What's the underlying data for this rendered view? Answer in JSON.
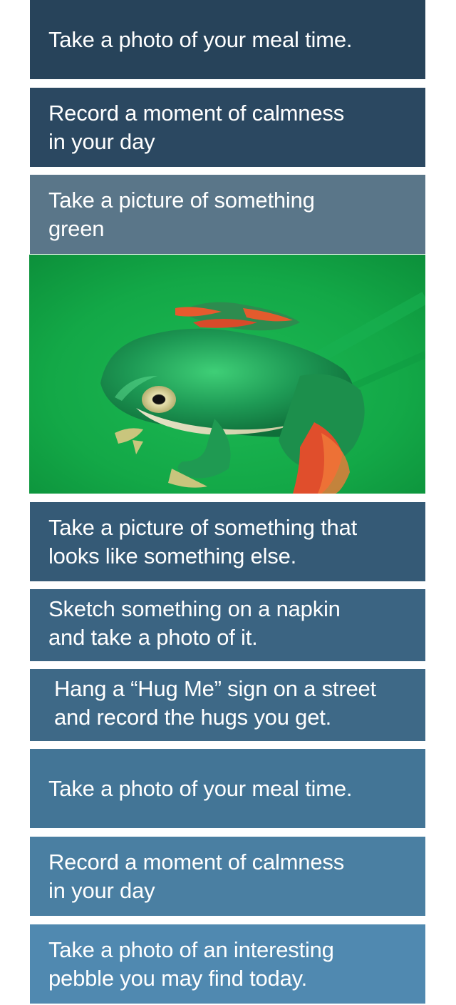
{
  "cards": [
    {
      "text": "Take a photo of your meal time."
    },
    {
      "text": "Record a moment of calmness\nin your day"
    },
    {
      "text": "Take a picture of something\ngreen"
    },
    {
      "text": "Take a picture of something that\nlooks like something else."
    },
    {
      "text": "Sketch something on a napkin\nand take a photo of it."
    },
    {
      "text": "Hang a “Hug Me” sign on a street\nand record the hugs you get."
    },
    {
      "text": "Take a photo of your meal time."
    },
    {
      "text": "Record a moment of calmness\nin your day"
    },
    {
      "text": "Take a photo of an interesting\npebble you may find today."
    }
  ],
  "photo": {
    "icon": "green-frog-photo"
  },
  "colors": {
    "card_1": "#27435a",
    "card_2": "#2b4861",
    "card_3_selected": "#5a7689",
    "card_4": "#355a76",
    "card_5": "#3b6482",
    "card_6": "#3e6987",
    "card_7": "#437596",
    "card_8": "#4a7fa2",
    "card_9": "#5089b0",
    "photo_background": "#12a64a"
  }
}
